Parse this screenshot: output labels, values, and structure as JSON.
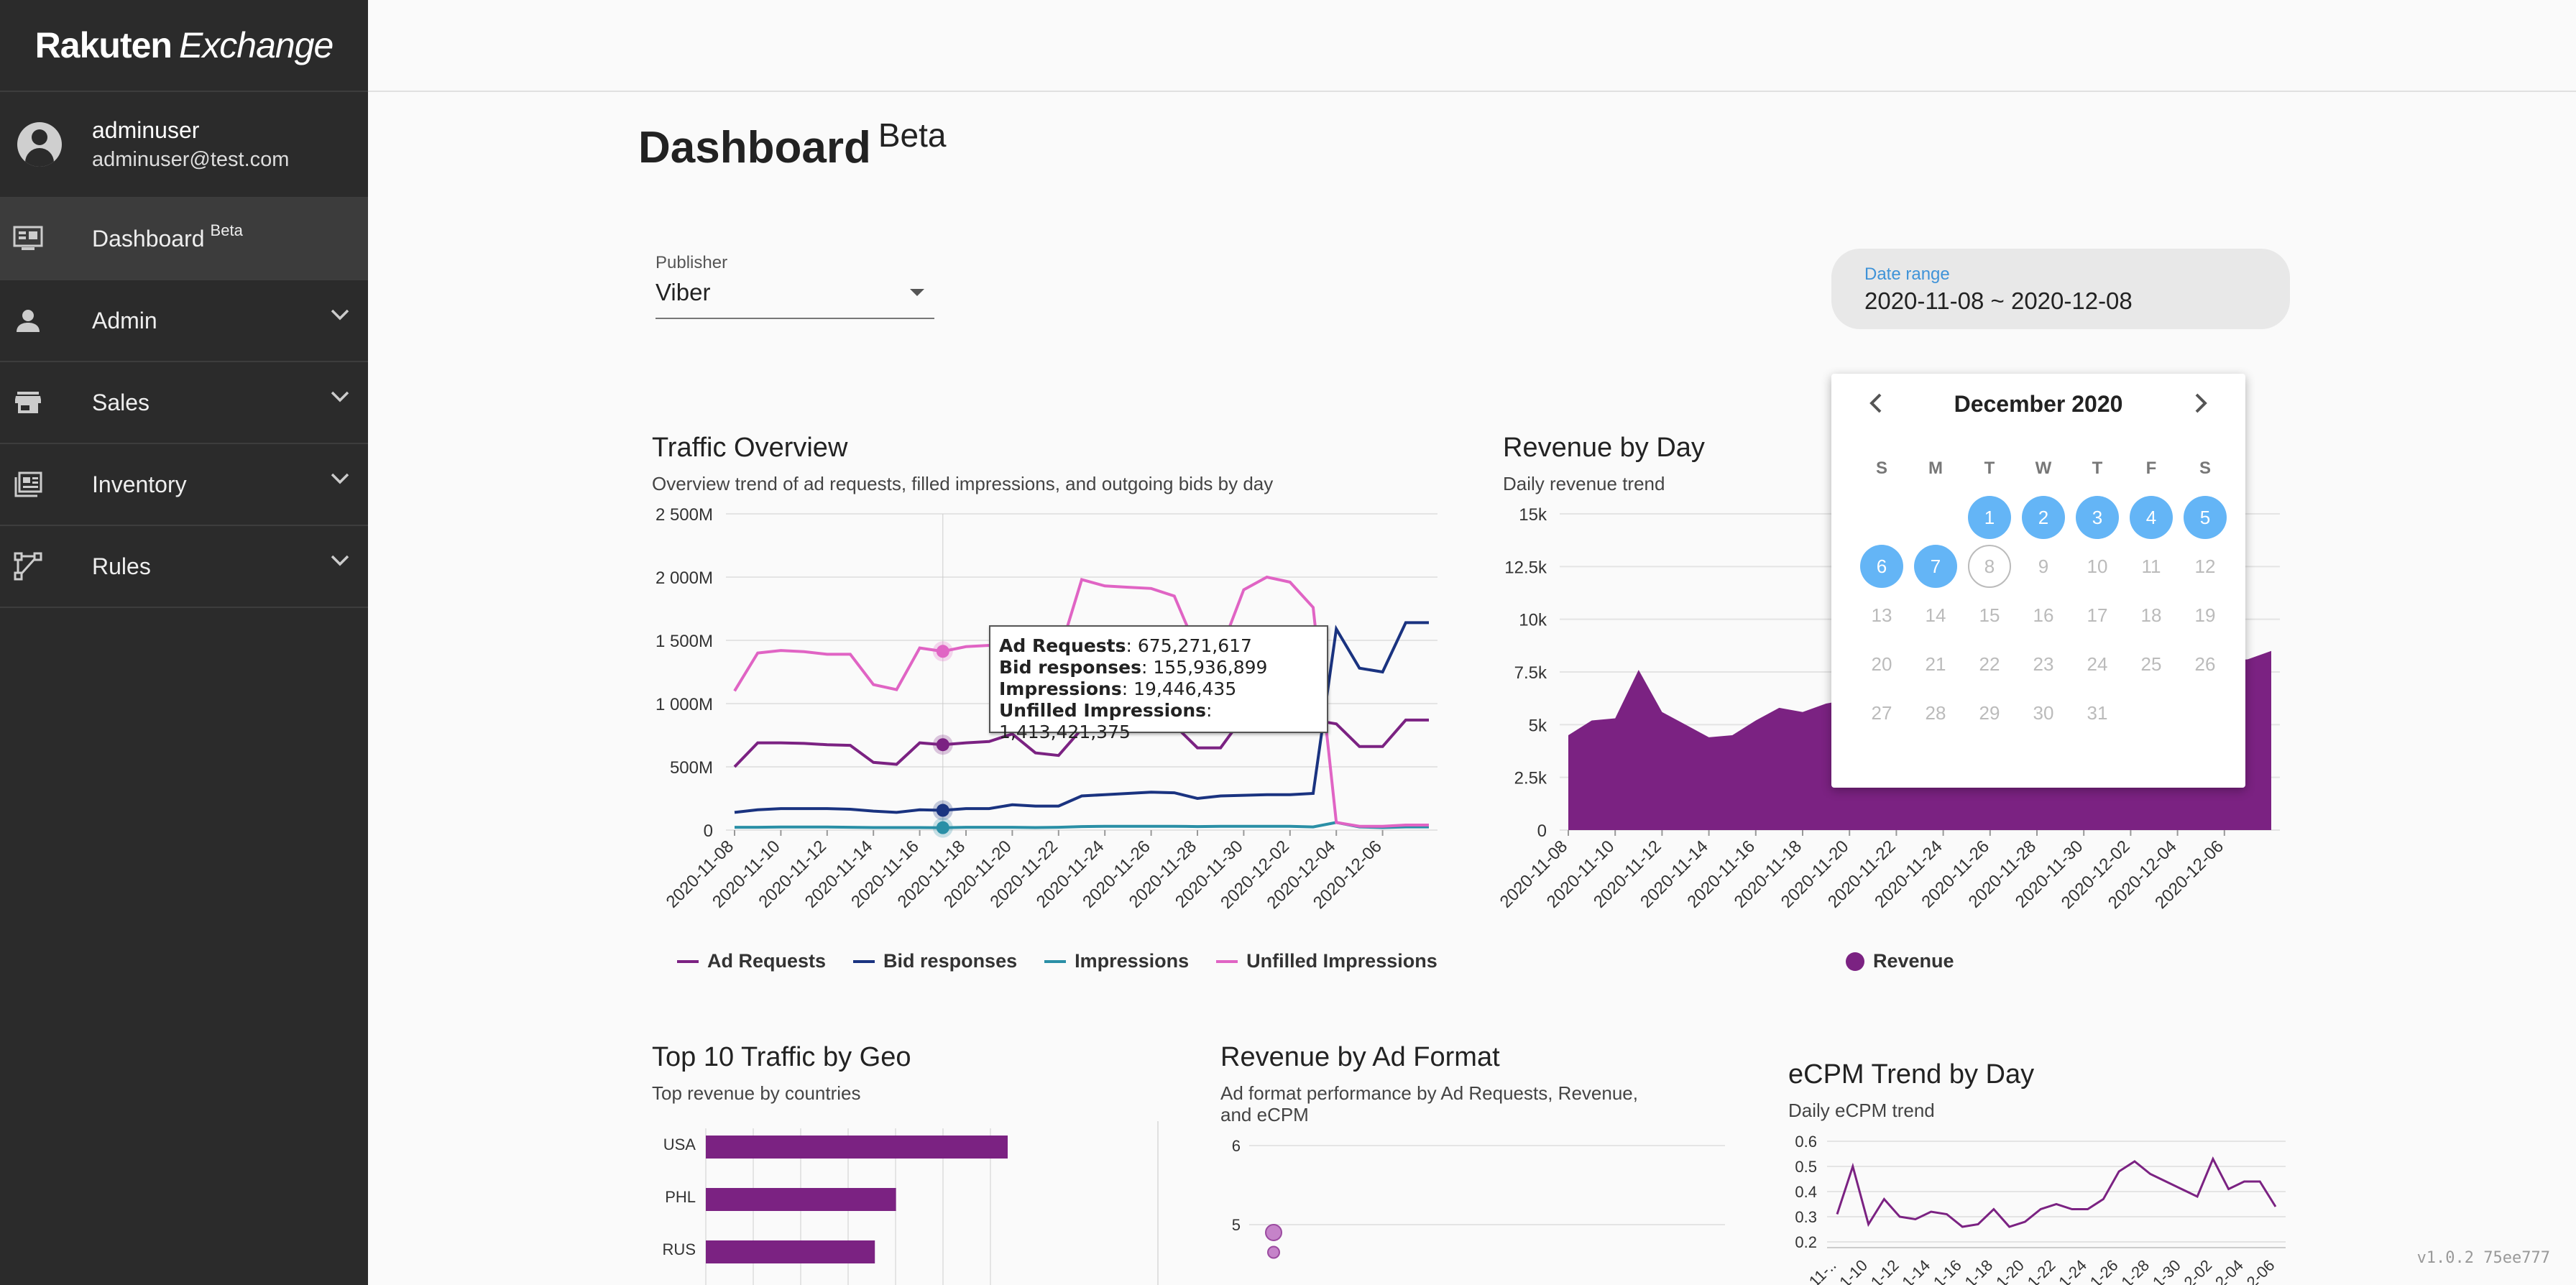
{
  "app": {
    "logo_bold": "Rakuten",
    "logo_rest": "Exchange"
  },
  "user": {
    "name": "adminuser",
    "email": "adminuser@test.com"
  },
  "sidebar": {
    "items": [
      {
        "label": "Dashboard",
        "badge": "Beta",
        "icon": "dashboard-icon"
      },
      {
        "label": "Admin",
        "icon": "person-icon"
      },
      {
        "label": "Sales",
        "icon": "store-icon"
      },
      {
        "label": "Inventory",
        "icon": "inventory-icon"
      },
      {
        "label": "Rules",
        "icon": "rules-icon"
      }
    ]
  },
  "page": {
    "title": "Dashboard",
    "badge": "Beta"
  },
  "filters": {
    "publisher_label": "Publisher",
    "publisher_value": "Viber",
    "date_label": "Date range",
    "date_value": "2020-11-08 ~ 2020-12-08"
  },
  "calendar": {
    "month": "December 2020",
    "dow": [
      "S",
      "M",
      "T",
      "W",
      "T",
      "F",
      "S"
    ],
    "weeks": [
      [
        "",
        "",
        "1",
        "2",
        "3",
        "4",
        "5"
      ],
      [
        "6",
        "7",
        "8",
        "9",
        "10",
        "11",
        "12"
      ],
      [
        "13",
        "14",
        "15",
        "16",
        "17",
        "18",
        "19"
      ],
      [
        "20",
        "21",
        "22",
        "23",
        "24",
        "25",
        "26"
      ],
      [
        "27",
        "28",
        "29",
        "30",
        "31",
        "",
        ""
      ]
    ],
    "selected": [
      "1",
      "2",
      "3",
      "4",
      "5",
      "6",
      "7"
    ],
    "today": "8",
    "accent": "#64b5f6"
  },
  "traffic": {
    "title": "Traffic Overview",
    "subtitle": "Overview trend of ad requests, filled impressions, and outgoing bids by day",
    "tooltip": {
      "ad_requests_label": "Ad Requests",
      "ad_requests": "675,271,617",
      "bid_label": "Bid responses",
      "bid": "155,936,899",
      "imp_label": "Impressions",
      "imp": "19,446,435",
      "unfilled_label": "Unfilled Impressions",
      "unfilled": "1,413,421,375"
    }
  },
  "revenue_day": {
    "title": "Revenue by Day",
    "subtitle": "Daily revenue trend"
  },
  "geo": {
    "title": "Top 10 Traffic by Geo",
    "subtitle": "Top revenue by countries"
  },
  "ad_format": {
    "title": "Revenue by Ad Format",
    "subtitle": "Ad format performance by Ad Requests, Revenue, and eCPM"
  },
  "ecpm": {
    "title": "eCPM Trend by Day",
    "subtitle": "Daily eCPM trend"
  },
  "version": "v1.0.2 75ee777",
  "chart_data": [
    {
      "type": "line",
      "title": "Traffic Overview",
      "x": [
        "2020-11-08",
        "2020-11-09",
        "2020-11-10",
        "2020-11-11",
        "2020-11-12",
        "2020-11-13",
        "2020-11-14",
        "2020-11-15",
        "2020-11-16",
        "2020-11-17",
        "2020-11-18",
        "2020-11-19",
        "2020-11-20",
        "2020-11-21",
        "2020-11-22",
        "2020-11-23",
        "2020-11-24",
        "2020-11-25",
        "2020-11-26",
        "2020-11-27",
        "2020-11-28",
        "2020-11-29",
        "2020-11-30",
        "2020-12-01",
        "2020-12-02",
        "2020-12-03",
        "2020-12-04",
        "2020-12-05",
        "2020-12-06",
        "2020-12-07",
        "2020-12-08"
      ],
      "x_tick_labels": [
        "2020-11-08",
        "2020-11-10",
        "2020-11-12",
        "2020-11-14",
        "2020-11-16",
        "2020-11-18",
        "2020-11-20",
        "2020-11-22",
        "2020-11-24",
        "2020-11-26",
        "2020-11-28",
        "2020-11-30",
        "2020-12-02",
        "2020-12-04",
        "2020-12-06"
      ],
      "y_ticks": [
        "0",
        "500M",
        "1 000M",
        "1 500M",
        "2 000M",
        "2 500M"
      ],
      "ylim": [
        0,
        2500
      ],
      "y_unit": "M",
      "series": [
        {
          "name": "Ad Requests",
          "color": "#7b2282",
          "values": [
            500,
            690,
            690,
            685,
            675,
            670,
            535,
            520,
            690,
            675,
            690,
            700,
            760,
            610,
            590,
            800,
            820,
            820,
            820,
            830,
            650,
            650,
            900,
            900,
            880,
            870,
            840,
            660,
            660,
            870,
            870
          ]
        },
        {
          "name": "Bid responses",
          "color": "#1a3380",
          "values": [
            140,
            160,
            170,
            170,
            170,
            165,
            150,
            140,
            160,
            156,
            170,
            170,
            200,
            190,
            190,
            270,
            280,
            290,
            300,
            295,
            250,
            270,
            275,
            280,
            280,
            290,
            1590,
            1280,
            1250,
            1640,
            1640
          ]
        },
        {
          "name": "Impressions",
          "color": "#2a8fa6",
          "values": [
            22,
            22,
            24,
            24,
            24,
            22,
            20,
            20,
            20,
            19,
            22,
            22,
            22,
            20,
            22,
            28,
            30,
            30,
            30,
            30,
            28,
            30,
            30,
            30,
            30,
            25,
            60,
            25,
            20,
            25,
            25
          ]
        },
        {
          "name": "Unfilled Impressions",
          "color": "#e064c4",
          "values": [
            1100,
            1400,
            1420,
            1410,
            1390,
            1390,
            1150,
            1110,
            1440,
            1413,
            1450,
            1460,
            1450,
            1380,
            1380,
            1980,
            1930,
            1920,
            1910,
            1850,
            1420,
            1420,
            1900,
            2000,
            1960,
            1760,
            60,
            30,
            30,
            40,
            40
          ]
        }
      ],
      "legend_position": "bottom"
    },
    {
      "type": "area",
      "title": "Revenue by Day",
      "x_tick_labels": [
        "2020-11-08",
        "2020-11-10",
        "2020-11-12",
        "2020-11-14",
        "2020-11-16",
        "2020-11-18",
        "2020-11-20",
        "2020-11-22",
        "2020-11-24",
        "2020-11-26",
        "2020-11-28",
        "2020-11-30",
        "2020-12-02",
        "2020-12-04",
        "2020-12-06"
      ],
      "y_ticks": [
        "0",
        "2.5k",
        "5k",
        "7.5k",
        "10k",
        "12.5k",
        "15k"
      ],
      "ylim": [
        0,
        15000
      ],
      "series": [
        {
          "name": "Revenue",
          "color": "#7b2282",
          "values": [
            4500,
            5200,
            5300,
            7600,
            5600,
            5000,
            4400,
            4500,
            5200,
            5800,
            5600,
            6000,
            6200,
            6100,
            6400,
            6600,
            6500,
            6800,
            6900,
            7000,
            7100,
            7200,
            7000,
            7400,
            7600,
            7500,
            7800,
            7900,
            8000,
            8100,
            8500
          ]
        }
      ],
      "legend_position": "bottom"
    },
    {
      "type": "bar",
      "title": "Top 10 Traffic by Geo",
      "categories": [
        "USA",
        "PHL",
        "RUS"
      ],
      "values": [
        100,
        63,
        56
      ]
    },
    {
      "type": "scatter",
      "title": "Revenue by Ad Format",
      "y_ticks": [
        "5",
        "6"
      ],
      "points": [
        {
          "y": 4.9
        },
        {
          "y": 4.65
        }
      ]
    },
    {
      "type": "line",
      "title": "eCPM Trend by Day",
      "x_tick_labels": [
        "11-..",
        "1-10",
        "1-12",
        "1-14",
        "1-16",
        "1-18",
        "1-20",
        "1-22",
        "1-24",
        "1-26",
        "1-28",
        "1-30",
        "2-02",
        "2-04",
        "2-06"
      ],
      "y_ticks": [
        "0.2",
        "0.3",
        "0.4",
        "0.5",
        "0.6"
      ],
      "ylim": [
        0.2,
        0.6
      ],
      "series": [
        {
          "name": "eCPM",
          "color": "#7b2282",
          "values": [
            0.31,
            0.5,
            0.27,
            0.37,
            0.3,
            0.29,
            0.32,
            0.31,
            0.26,
            0.27,
            0.33,
            0.26,
            0.28,
            0.33,
            0.35,
            0.33,
            0.33,
            0.37,
            0.48,
            0.52,
            0.47,
            0.44,
            0.41,
            0.38,
            0.53,
            0.41,
            0.44,
            0.44,
            0.34
          ]
        }
      ]
    }
  ]
}
